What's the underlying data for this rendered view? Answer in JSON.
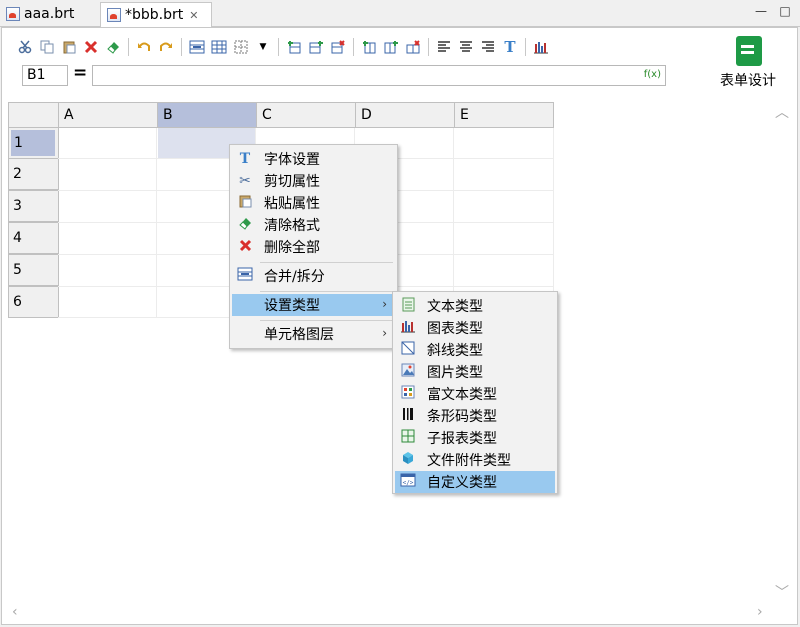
{
  "tabs": [
    {
      "label": "aaa.brt",
      "active": false
    },
    {
      "label": "*bbb.brt",
      "active": true
    }
  ],
  "formula_bar": {
    "cell_ref": "B1",
    "equals": "=",
    "formula": "",
    "fx_label": "f(x)"
  },
  "design_button": {
    "label": "表单设计",
    "icon": "form-design-icon"
  },
  "grid": {
    "columns": [
      "A",
      "B",
      "C",
      "D",
      "E"
    ],
    "rows": [
      "1",
      "2",
      "3",
      "4",
      "5",
      "6"
    ],
    "selected_cell": "B1"
  },
  "context_menu": {
    "items": [
      {
        "label": "字体设置",
        "icon": "font-icon"
      },
      {
        "label": "剪切属性",
        "icon": "scissors-icon"
      },
      {
        "label": "粘贴属性",
        "icon": "paste-icon"
      },
      {
        "label": "清除格式",
        "icon": "eraser-icon"
      },
      {
        "label": "删除全部",
        "icon": "delete-icon"
      },
      {
        "label": "合并/拆分",
        "icon": "merge-icon"
      },
      {
        "label": "设置类型",
        "icon": "",
        "submenu": true,
        "highlighted": true
      },
      {
        "label": "单元格图层",
        "icon": "",
        "submenu": true
      }
    ]
  },
  "type_submenu": {
    "items": [
      {
        "label": "文本类型",
        "icon": "text-type-icon"
      },
      {
        "label": "图表类型",
        "icon": "chart-type-icon"
      },
      {
        "label": "斜线类型",
        "icon": "diagonal-type-icon"
      },
      {
        "label": "图片类型",
        "icon": "image-type-icon"
      },
      {
        "label": "富文本类型",
        "icon": "rich-text-type-icon"
      },
      {
        "label": "条形码类型",
        "icon": "barcode-type-icon"
      },
      {
        "label": "子报表类型",
        "icon": "subreport-type-icon"
      },
      {
        "label": "文件附件类型",
        "icon": "attachment-type-icon"
      },
      {
        "label": "自定义类型",
        "icon": "custom-type-icon",
        "highlighted": true
      }
    ]
  },
  "colors": {
    "accent_highlight": "#99c9ef",
    "header_selected": "#b5bfdb",
    "cell_selected": "#dde1ee"
  }
}
